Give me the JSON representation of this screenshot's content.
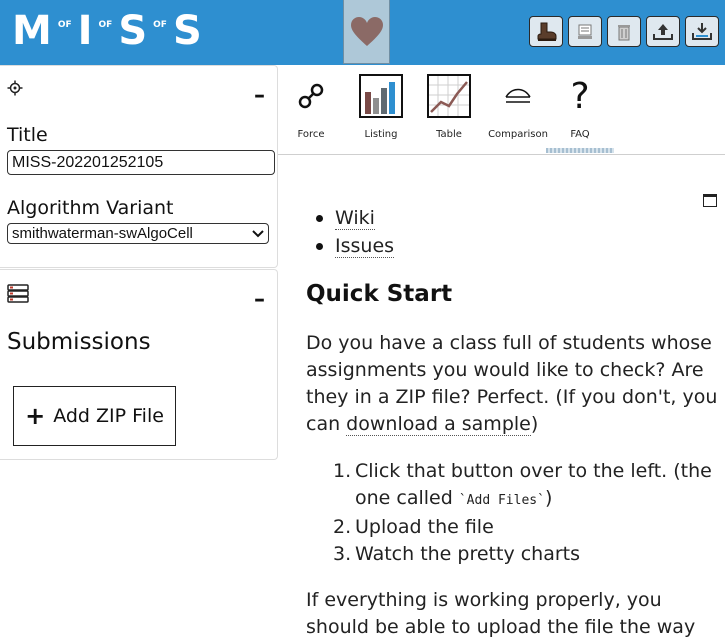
{
  "header": {
    "logo": {
      "letters": [
        "M",
        "I",
        "S",
        "S"
      ],
      "separator": "OF"
    },
    "heart_icon": "heart-icon",
    "toolbar_icons": [
      "boot-icon",
      "document-icon",
      "trash-icon",
      "upload-icon",
      "save-icon"
    ]
  },
  "settings_panel": {
    "icon": "gear-icon",
    "collapse_label": "–",
    "title_label": "Title",
    "title_value": "MISS-202201252105",
    "variant_label": "Algorithm Variant",
    "variant_value": "smithwaterman-swAlgoCell"
  },
  "submissions_panel": {
    "icon": "books-icon",
    "collapse_label": "–",
    "heading": "Submissions",
    "add_button_label": "Add ZIP File"
  },
  "tabs": [
    {
      "label": "Force",
      "icon": "force-graph-icon"
    },
    {
      "label": "Listing",
      "icon": "bar-chart-icon"
    },
    {
      "label": "Table",
      "icon": "line-chart-icon"
    },
    {
      "label": "Comparison",
      "icon": "comparison-icon"
    },
    {
      "label": "FAQ",
      "icon": "question-icon",
      "glyph": "?"
    }
  ],
  "active_tab": "FAQ",
  "faq": {
    "links": [
      "Wiki",
      "Issues"
    ],
    "heading": "Quick Start",
    "intro_before_link": "Do you have a class full of students whose assignments you would like to check? Are they in a ZIP file? Perfect. (If you don't, you can ",
    "intro_link": "download a sample",
    "intro_after_link": ")",
    "steps": [
      {
        "num": "1.",
        "text": "Click that button over to the left. (the one called ",
        "code": "`Add Files`",
        "after": ")"
      },
      {
        "num": "2.",
        "text": "Upload the file"
      },
      {
        "num": "3.",
        "text": "Watch the pretty charts"
      }
    ],
    "outro": "If everything is working properly, you should be able to upload the file the way you"
  }
}
